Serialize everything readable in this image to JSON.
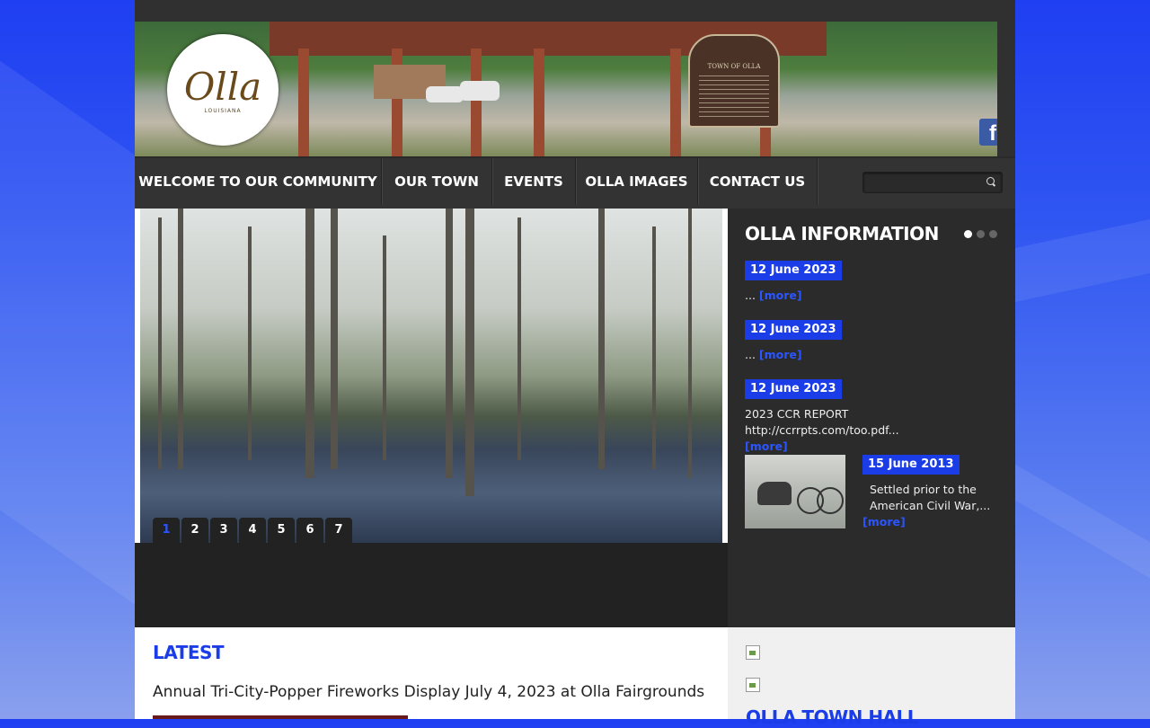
{
  "header": {
    "logo": {
      "text": "Olla",
      "subtext": "LOUISIANA"
    },
    "sign_title": "TOWN OF OLLA",
    "social": {
      "icon": "facebook-icon",
      "label": "f"
    }
  },
  "nav": {
    "items": [
      {
        "label": "WELCOME TO OUR COMMUNITY"
      },
      {
        "label": "OUR TOWN"
      },
      {
        "label": "EVENTS"
      },
      {
        "label": "OLLA IMAGES"
      },
      {
        "label": "CONTACT US"
      }
    ],
    "search": {
      "placeholder": "",
      "icon": "search-icon"
    }
  },
  "slider": {
    "pages": [
      "1",
      "2",
      "3",
      "4",
      "5",
      "6",
      "7"
    ],
    "active_page": "1"
  },
  "info": {
    "title": "OLLA INFORMATION",
    "items": [
      {
        "date": "12 June 2023",
        "text": "...",
        "more": "[more]"
      },
      {
        "date": "12 June 2023",
        "text": "...",
        "more": "[more]"
      },
      {
        "date": "12 June 2023",
        "text": "2023 CCR REPORT http://ccrrpts.com/too.pdf...",
        "more": "[more]"
      },
      {
        "date": "15 June 2013",
        "text": "Settled prior to the American Civil War,...",
        "more": "[more]"
      }
    ]
  },
  "latest": {
    "heading": "LATEST",
    "article_title": "Annual Tri-City-Popper Fireworks Display July 4, 2023 at Olla Fairgrounds"
  },
  "aside": {
    "heading": "OLLA TOWN HALL"
  },
  "colors": {
    "accent": "#1a3de8",
    "nav_bg": "#333333",
    "panel_bg": "#2b2b2b"
  }
}
